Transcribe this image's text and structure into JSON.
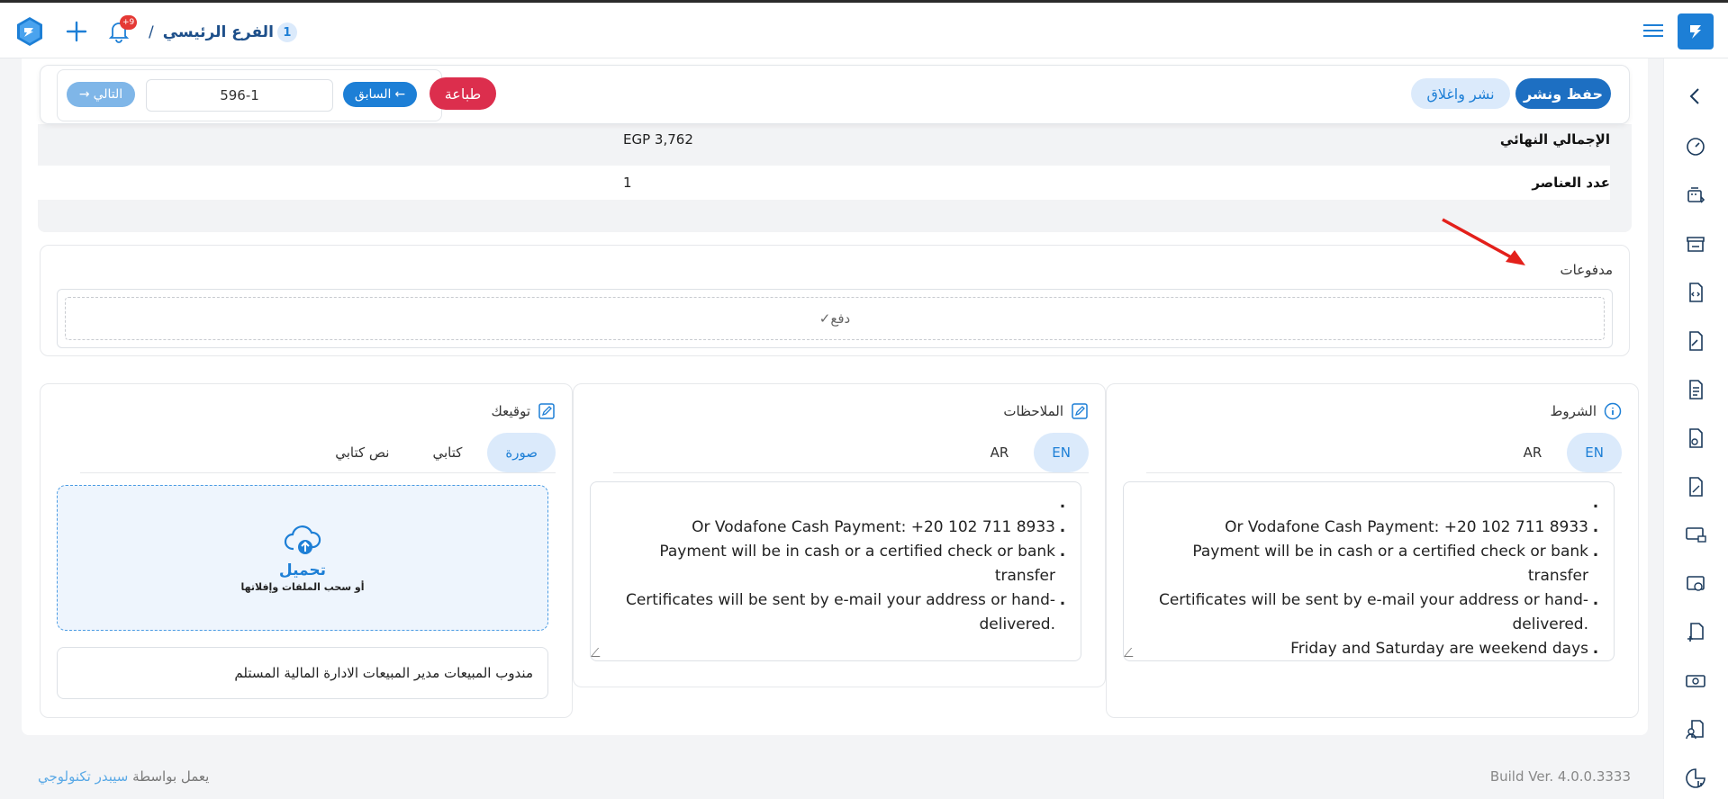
{
  "header": {
    "branch_number": "1",
    "branch_name": "الفرع الرئيسي",
    "branch_separator": "/",
    "notification_badge": "+9"
  },
  "toolbar": {
    "save_publish_label": "حفظ ونشر",
    "publish_close_label": "نشر واغلاق",
    "print_label": "طباعة",
    "prev_label": "السابق",
    "next_label": "التالي",
    "document_number": "596-1"
  },
  "totals": {
    "grand_total_label": "الإجمالي النهائي",
    "grand_total_value": "EGP 3,762",
    "items_count_label": "عدد العناصر",
    "items_count_value": "1"
  },
  "payments": {
    "title": "مدفوعات",
    "pay_button_label": "دفع"
  },
  "terms": {
    "title": "الشروط",
    "tabs": [
      "EN",
      "AR"
    ],
    "active_tab": "EN",
    "lines": [
      "",
      "Or Vodafone Cash Payment: +20 102 711 8933",
      "Payment will be in cash or a certified check or bank transfer",
      "Certificates will be sent by e-mail your address or hand-delivered.",
      "Friday and Saturday are weekend days"
    ]
  },
  "notes": {
    "title": "الملاحظات",
    "tabs": [
      "EN",
      "AR"
    ],
    "active_tab": "EN",
    "lines": [
      "",
      "Or Vodafone Cash Payment: +20 102 711 8933",
      "Payment will be in cash or a certified check or bank transfer",
      "Certificates will be sent by e-mail your address or hand-delivered."
    ]
  },
  "signature": {
    "title": "توقيعك",
    "tabs": [
      "صورة",
      "كتابي",
      "نص كتابي"
    ],
    "active_tab": "صورة",
    "upload_label": "تحميل",
    "upload_hint": "أو سحب الملفات وإفلاتها",
    "names": "مندوب المبيعات مدير المبيعات الادارة المالية المستلم"
  },
  "footer": {
    "powered_by": "يعمل بواسطة",
    "brand": "سيبدر تكنولوجي",
    "build": "Build Ver. 4.0.0.3333"
  },
  "colors": {
    "primary": "#1d7fd6",
    "danger": "#dc2e4d",
    "light_primary": "#dbeafb",
    "arrow": "#e3201b"
  },
  "sidebar_icons": [
    "chevron-left-icon",
    "speedometer-icon",
    "sales-register-icon",
    "store-icon",
    "document-code-icon",
    "document-tag-icon",
    "document-lines-icon",
    "document-edit-icon",
    "document-discount-icon",
    "monitor-card-icon",
    "camera-plus-icon",
    "document-add-icon",
    "cash-icon",
    "user-document-icon",
    "report-chart-icon"
  ]
}
